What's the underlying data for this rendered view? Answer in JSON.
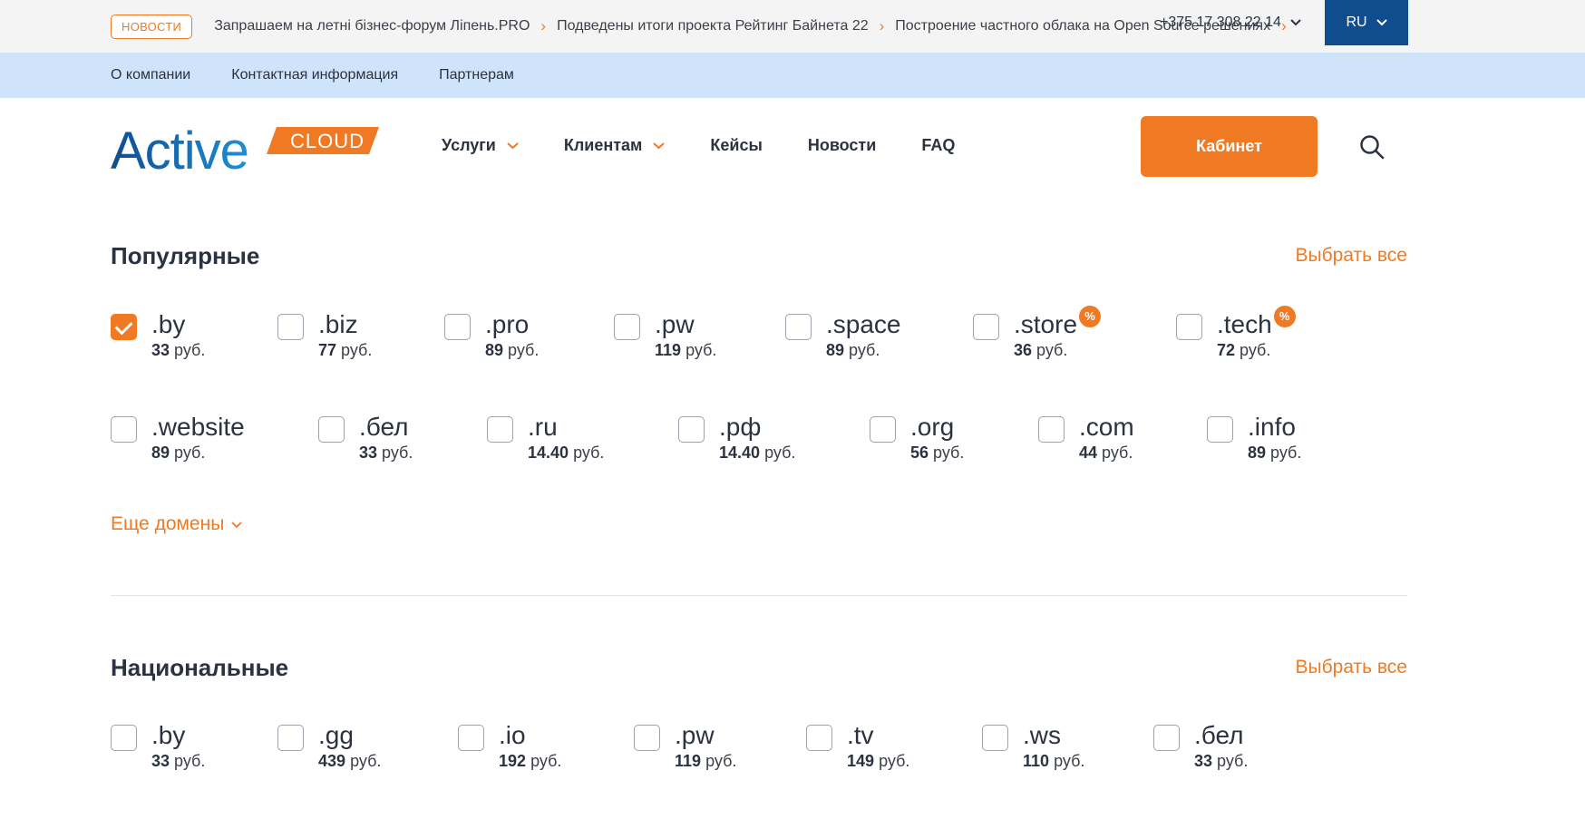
{
  "news": {
    "badge": "НОВОСТИ",
    "items": [
      "Запрашаем на летні бізнес-форум Ліпень.PRO",
      "Подведены итоги проекта Рейтинг Байнета 22",
      "Построение частного облака на Open Source решениях"
    ]
  },
  "infobar": {
    "links": [
      "О компании",
      "Контактная информация",
      "Партнерам"
    ],
    "phone": "+375 17 308 22 14",
    "lang": "RU"
  },
  "logo": {
    "word": "Active",
    "tag": "CLOUD"
  },
  "nav": {
    "items": [
      {
        "label": "Услуги",
        "dropdown": true
      },
      {
        "label": "Клиентам",
        "dropdown": true
      },
      {
        "label": "Кейсы",
        "dropdown": false
      },
      {
        "label": "Новости",
        "dropdown": false
      },
      {
        "label": "FAQ",
        "dropdown": false
      }
    ],
    "cabinet": "Кабинет"
  },
  "popular": {
    "title": "Популярные",
    "select_all": "Выбрать все",
    "domains": [
      {
        "name": ".by",
        "price": "33",
        "unit": "руб.",
        "checked": true,
        "promo": false
      },
      {
        "name": ".biz",
        "price": "77",
        "unit": "руб.",
        "checked": false,
        "promo": false
      },
      {
        "name": ".pro",
        "price": "89",
        "unit": "руб.",
        "checked": false,
        "promo": false
      },
      {
        "name": ".pw",
        "price": "119",
        "unit": "руб.",
        "checked": false,
        "promo": false
      },
      {
        "name": ".space",
        "price": "89",
        "unit": "руб.",
        "checked": false,
        "promo": false
      },
      {
        "name": ".store",
        "price": "36",
        "unit": "руб.",
        "checked": false,
        "promo": true
      },
      {
        "name": ".tech",
        "price": "72",
        "unit": "руб.",
        "checked": false,
        "promo": true
      },
      {
        "name": ".website",
        "price": "89",
        "unit": "руб.",
        "checked": false,
        "promo": false
      },
      {
        "name": ".бел",
        "price": "33",
        "unit": "руб.",
        "checked": false,
        "promo": false
      },
      {
        "name": ".ru",
        "price": "14.40",
        "unit": "руб.",
        "checked": false,
        "promo": false
      },
      {
        "name": ".рф",
        "price": "14.40",
        "unit": "руб.",
        "checked": false,
        "promo": false
      },
      {
        "name": ".org",
        "price": "56",
        "unit": "руб.",
        "checked": false,
        "promo": false
      },
      {
        "name": ".com",
        "price": "44",
        "unit": "руб.",
        "checked": false,
        "promo": false
      },
      {
        "name": ".info",
        "price": "89",
        "unit": "руб.",
        "checked": false,
        "promo": false
      }
    ],
    "more": "Еще домены"
  },
  "national": {
    "title": "Национальные",
    "select_all": "Выбрать все",
    "domains": [
      {
        "name": ".by",
        "price": "33",
        "unit": "руб.",
        "checked": false,
        "promo": false
      },
      {
        "name": ".gg",
        "price": "439",
        "unit": "руб.",
        "checked": false,
        "promo": false
      },
      {
        "name": ".io",
        "price": "192",
        "unit": "руб.",
        "checked": false,
        "promo": false
      },
      {
        "name": ".pw",
        "price": "119",
        "unit": "руб.",
        "checked": false,
        "promo": false
      },
      {
        "name": ".tv",
        "price": "149",
        "unit": "руб.",
        "checked": false,
        "promo": false
      },
      {
        "name": ".ws",
        "price": "110",
        "unit": "руб.",
        "checked": false,
        "promo": false
      },
      {
        "name": ".бел",
        "price": "33",
        "unit": "руб.",
        "checked": false,
        "promo": false
      }
    ]
  },
  "colors": {
    "accent": "#f07a23",
    "navy": "#0f4d8f",
    "infobar": "#cfe4fb",
    "text": "#2b3240"
  },
  "icons": {
    "search": "search-icon",
    "promo": "percent-badge-icon",
    "dropdown": "chevron-down-icon",
    "news_next": "chevron-right-icon"
  }
}
